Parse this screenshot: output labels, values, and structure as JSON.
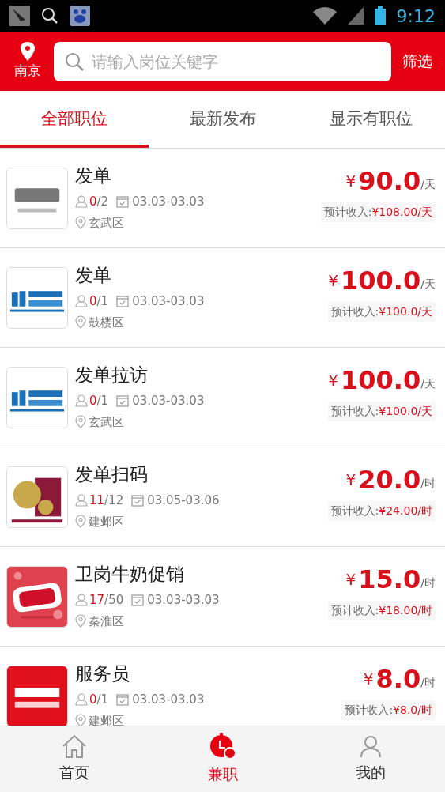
{
  "status_bar": {
    "time": "9:12"
  },
  "header": {
    "city": "南京",
    "search": {
      "placeholder": "请输入岗位关键字"
    },
    "filter": "筛选"
  },
  "tabs": [
    {
      "label": "全部职位",
      "selected": true
    },
    {
      "label": "最新发布",
      "selected": false
    },
    {
      "label": "显示有职位",
      "selected": false
    }
  ],
  "jobs": [
    {
      "title": "发单",
      "applied": "0",
      "capacity": "/2",
      "dates": "03.03-03.03",
      "district": "玄武区",
      "currency": "¥",
      "price": "90.0",
      "unit": "/天",
      "estimate_label": "预计收入:",
      "estimate": "¥108.00/天"
    },
    {
      "title": "发单",
      "applied": "0",
      "capacity": "/1",
      "dates": "03.03-03.03",
      "district": "鼓楼区",
      "currency": "¥",
      "price": "100.0",
      "unit": "/天",
      "estimate_label": "预计收入:",
      "estimate": "¥100.0/天"
    },
    {
      "title": "发单拉访",
      "applied": "0",
      "capacity": "/1",
      "dates": "03.03-03.03",
      "district": "玄武区",
      "currency": "¥",
      "price": "100.0",
      "unit": "/天",
      "estimate_label": "预计收入:",
      "estimate": "¥100.0/天"
    },
    {
      "title": "发单扫码",
      "applied": "11",
      "capacity": "/12",
      "dates": "03.05-03.06",
      "district": "建邺区",
      "currency": "¥",
      "price": "20.0",
      "unit": "/时",
      "estimate_label": "预计收入:",
      "estimate": "¥24.00/时"
    },
    {
      "title": "卫岗牛奶促销",
      "applied": "17",
      "capacity": "/50",
      "dates": "03.03-03.03",
      "district": "秦淮区",
      "currency": "¥",
      "price": "15.0",
      "unit": "/时",
      "estimate_label": "预计收入:",
      "estimate": "¥18.00/时"
    },
    {
      "title": "服务员",
      "applied": "0",
      "capacity": "/1",
      "dates": "03.03-03.03",
      "district": "建邺区",
      "currency": "¥",
      "price": "8.0",
      "unit": "/时",
      "estimate_label": "预计收入:",
      "estimate": "¥8.0/时"
    }
  ],
  "nav": [
    {
      "label": "首页",
      "selected": false
    },
    {
      "label": "兼职",
      "selected": true
    },
    {
      "label": "我的",
      "selected": false
    }
  ]
}
